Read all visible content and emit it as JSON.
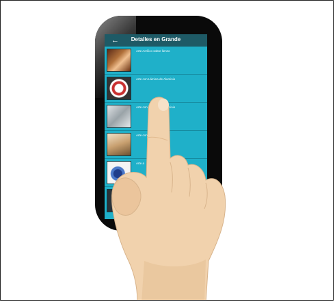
{
  "app": {
    "title": "Detalles en Grande",
    "back_icon": "arrow-left-icon"
  },
  "list": {
    "items": [
      {
        "label": "Arte Acrílico sobre lienzo",
        "thumb": "abstract-art-thumbnail"
      },
      {
        "label": "Arte con Lámina de Aluminio",
        "thumb": "aluminum-art-thumbnail"
      },
      {
        "label": "Arte con Lámina de Aluminio",
        "thumb": "aluminum-art-thumbnail"
      },
      {
        "label": "Arte con",
        "thumb": "sculpture-thumbnail"
      },
      {
        "label": "Arte a",
        "thumb": "blue-art-thumbnail"
      },
      {
        "label": "",
        "thumb": "dark-thumbnail"
      }
    ]
  },
  "colors": {
    "appbar": "#1e5a66",
    "screen": "#1fb0c9",
    "phone_body": "#0a0a0a",
    "skin": "#f1d2ad",
    "skin_shadow": "#e0b98e"
  }
}
